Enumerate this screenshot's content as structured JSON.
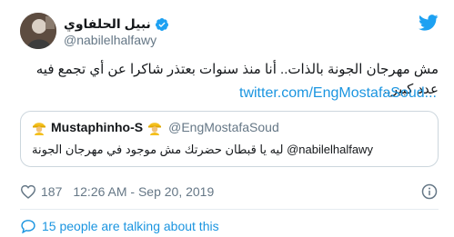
{
  "header": {
    "user_name": "نبيل الحلفاوي",
    "handle": "@nabilelhalfawy"
  },
  "tweet": {
    "text": "مش مهرجان الجونة بالذات.. أنا منذ سنوات بعتذر شاكرا عن أي تجمع فيه عدد كبير..",
    "link": "twitter.com/EngMostafaSoud..."
  },
  "quoted": {
    "name": "Mustaphinho-S",
    "handle": "@EngMostafaSoud",
    "mention": "@nabilelhalfawy",
    "text": "ليه يا قبطان حضرتك مش موجود في مهرجان الجونة"
  },
  "meta": {
    "likes": "187",
    "timestamp": "12:26 AM - Sep 20, 2019"
  },
  "footer": {
    "talking": "15 people are talking about this"
  },
  "colors": {
    "link": "#1b95e0",
    "secondary": "#657786",
    "border": "#ccd6dd"
  },
  "icons": [
    "verified-badge-icon",
    "twitter-bird-icon",
    "emoji-construction-worker-icon",
    "heart-icon",
    "info-icon",
    "speech-bubble-icon"
  ]
}
